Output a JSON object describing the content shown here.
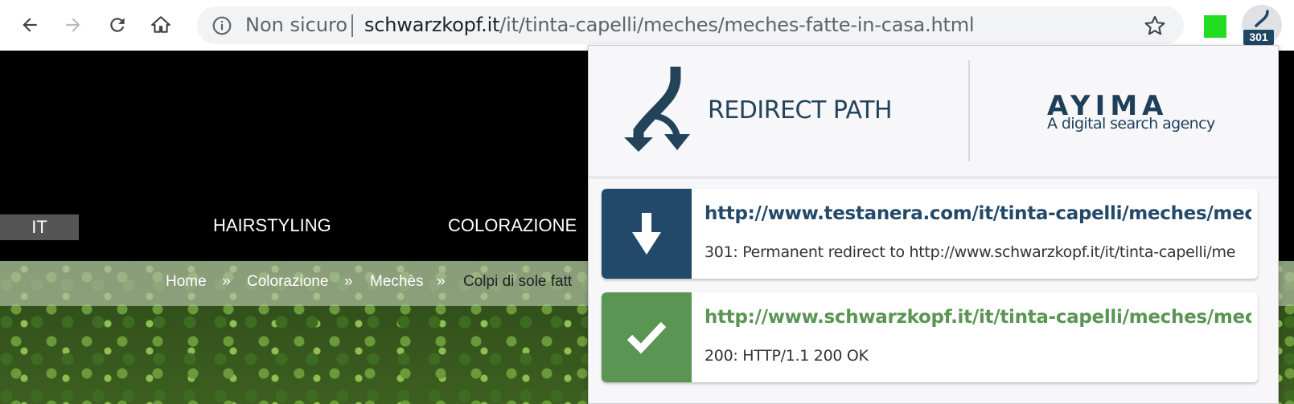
{
  "browser": {
    "security_label": "Non sicuro",
    "url_domain": "schwarzkopf.it",
    "url_path": "/it/tinta-capelli/meches/meches-fatte-in-casa.html",
    "extension_badge": "301",
    "colors": {
      "badge_bg": "#1e4763",
      "green_ext": "#22dd22"
    }
  },
  "site": {
    "nav": {
      "language": "IT",
      "items": [
        "HAIRSTYLING",
        "COLORAZIONE"
      ]
    },
    "breadcrumb": {
      "home": "Home",
      "sep": "»",
      "level1": "Colorazione",
      "level2": "Mechès",
      "current": "Colpi di sole fatt"
    }
  },
  "popup": {
    "title": "REDIRECT PATH",
    "partner_name": "AYIMA",
    "partner_tagline": "A digital search agency",
    "hops": [
      {
        "url": "http://www.testanera.com/it/tinta-capelli/meches/meches-fa",
        "status": "301: Permanent redirect to http://www.schwarzkopf.it/it/tinta-capelli/me",
        "icon": "arrow-down-icon",
        "color": "#23496a"
      },
      {
        "url": "http://www.schwarzkopf.it/it/tinta-capelli/meches/meches-fa",
        "status": "200: HTTP/1.1 200 OK",
        "icon": "check-icon",
        "color": "#5a9553"
      }
    ]
  }
}
